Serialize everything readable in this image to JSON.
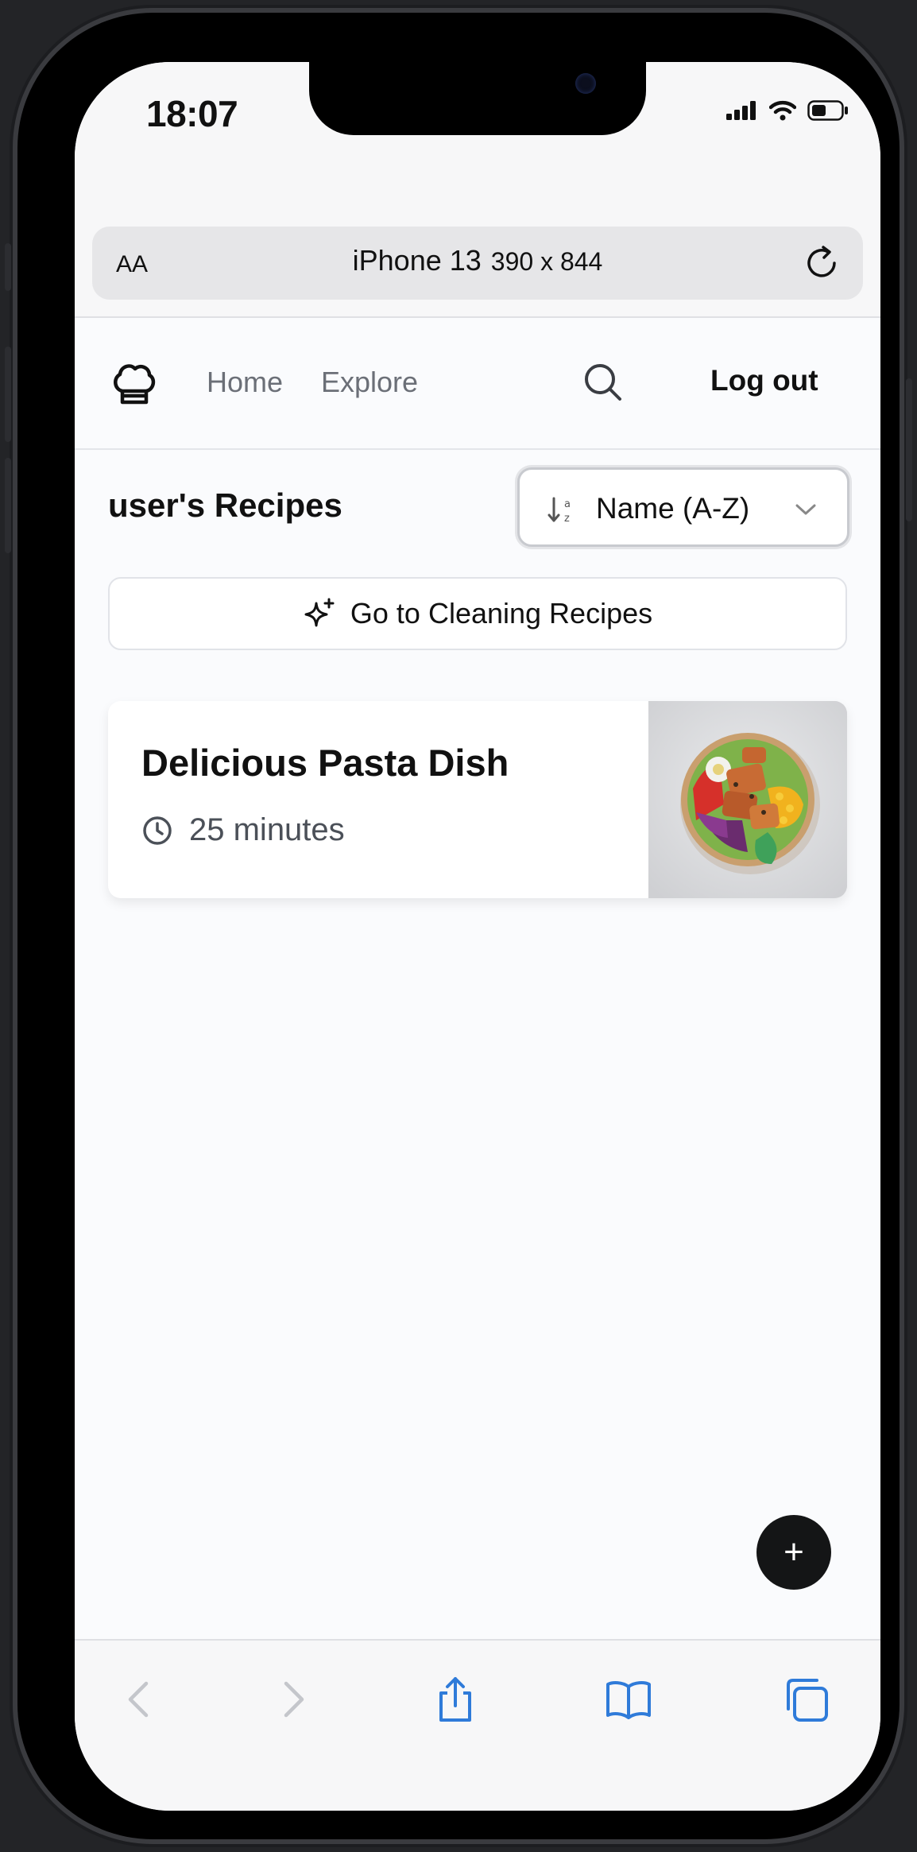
{
  "status_bar": {
    "time": "18:07"
  },
  "browser": {
    "text_size_label": "AA",
    "device_name": "iPhone 13",
    "device_dims": "390 x 844"
  },
  "nav": {
    "home": "Home",
    "explore": "Explore",
    "logout": "Log out"
  },
  "page": {
    "title": "user's Recipes",
    "sort": {
      "selected": "Name (A-Z)"
    },
    "cleaning_button": "Go to Cleaning Recipes"
  },
  "recipes": [
    {
      "title": "Delicious Pasta Dish",
      "time": "25 minutes"
    }
  ],
  "fab": {
    "label": "+"
  },
  "colors": {
    "background": "#fafbfd",
    "text": "#111111",
    "muted": "#6b6f77",
    "ios_blue": "#2f7bd9",
    "fab": "#141516"
  }
}
